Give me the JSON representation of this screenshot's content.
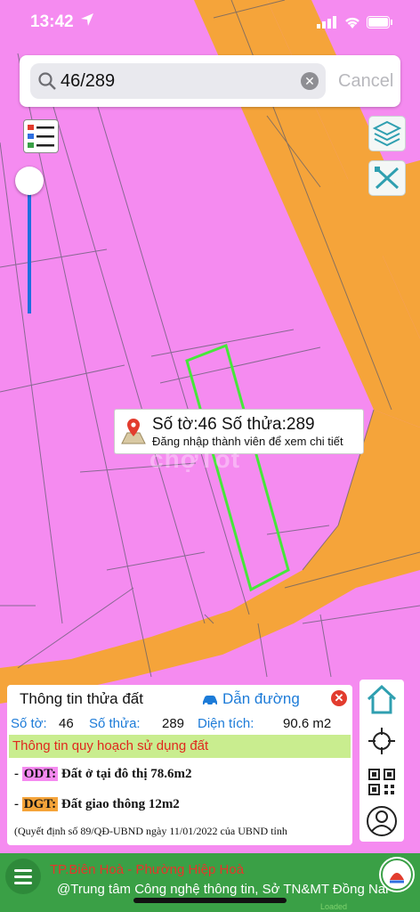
{
  "status": {
    "time": "13:42"
  },
  "search": {
    "query": "46/289",
    "cancel_label": "Cancel"
  },
  "popup": {
    "line1": "Số tờ:46 Số thửa:289",
    "line2": "Đăng nhập thành viên để xem chi tiết"
  },
  "watermark": "chợTốt",
  "panel": {
    "title": "Thông tin thửa đất",
    "directions_label": "Dẫn đường",
    "to_label": "Số tờ:",
    "to_value": "46",
    "thua_label": "Số thửa:",
    "thua_value": "289",
    "area_label": "Diện tích:",
    "area_value": "90.6 m2",
    "section_title": "Thông tin quy hoạch sử dụng đất",
    "rows": [
      {
        "prefix": "- ",
        "code": "ODT:",
        "desc": " Đất ở tại đô thị 78.6m2"
      },
      {
        "prefix": "- ",
        "code": "DGT:",
        "desc": " Đất giao thông 12m2"
      }
    ],
    "note": "(Quyết định số 89/QĐ-UBND ngày 11/01/2022 của UBND tỉnh"
  },
  "footer": {
    "line1": "TP.Biên Hoà - Phường Hiệp Hoà",
    "line2": "@Trung tâm Công nghệ thông tin, Sở TN&MT Đồng Nai",
    "loaded": "Loaded"
  },
  "colors": {
    "residential": "#f58bf0",
    "road": "#f5a43a",
    "parcel_highlight": "#46e83a",
    "odt_badge": "#f58bf0",
    "dgt_badge": "#f5a43a",
    "accent": "#1c7bd8",
    "footer_bg": "#3aa046"
  },
  "icons": {
    "status_arrow": "location-arrow-icon",
    "search": "search-icon",
    "clear": "clear-icon",
    "legend": "legend-list-icon",
    "layers": "layers-icon",
    "measure": "measure-tools-icon",
    "pin": "map-pin-icon",
    "car": "car-icon",
    "home": "home-icon",
    "locate": "crosshair-icon",
    "qr": "qr-code-icon",
    "account": "user-icon",
    "menu": "menu-icon"
  }
}
